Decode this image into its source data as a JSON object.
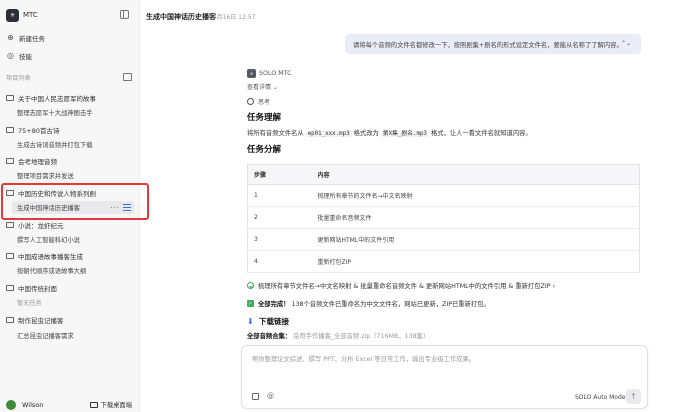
{
  "sidebar": {
    "brand": "MTC",
    "new_task": "新建任务",
    "skills": "技能",
    "section_projects": "项目列表",
    "groups": [
      {
        "label": "关于中国人民志愿军的故事",
        "children": [
          "整理志愿军十大战神图击手"
        ]
      },
      {
        "label": "75+80首古诗",
        "children": [
          "生成古诗词音频并打包下载"
        ]
      },
      {
        "label": "会考地理音频",
        "children": [
          "整理项目需求并发送"
        ]
      },
      {
        "label": "中国历史和传说人物系列剧",
        "children": [
          "生成中国神话历史播客"
        ]
      },
      {
        "label": "小说：龙虾纪元",
        "children": [
          "撰写人工智能科幻小说"
        ]
      },
      {
        "label": "中国成语故事播客生成",
        "children": [
          "按朝代顺序成语故事大纲"
        ]
      },
      {
        "label": "中国传统封面",
        "children": []
      }
    ],
    "section_temp": "暂无任务",
    "extra_items": [
      "制作昆虫记播客",
      "汇总昆虫记播客需求"
    ],
    "user": "Wilson",
    "download": "下载桌面端"
  },
  "header": {
    "title": "生成中国神话历史播客",
    "time": "04月16日 12:57"
  },
  "chat": {
    "user_message": "请将每个音频的文件名都修改一下，按照剧集+剧名的形式设定文件名，要能从名称了了解内容。",
    "agent_name": "SOLO MTC",
    "view_details": "查看详情 ⌄",
    "thinking": "思考",
    "section1_title": "任务理解",
    "section1_text_a": "将所有音频文件名从",
    "section1_code_a": "ep01_xxx.mp3",
    "section1_text_b": "格式改为",
    "section1_code_b": "第X集_剧名.mp3",
    "section1_text_c": "格式，让人一看文件名就知道内容。",
    "section2_title": "任务分解",
    "table_headers": [
      "步骤",
      "内容"
    ],
    "table_rows": [
      [
        "1",
        "梳理所有章节的文件名→中文名映射"
      ],
      [
        "2",
        "批量重命名音频文件"
      ],
      [
        "3",
        "更新网站HTML中的文件引用"
      ],
      [
        "4",
        "重新打包ZIP"
      ]
    ],
    "progress_line": "梳理所有章节文件名→中文名映射 & 批量重命名音频文件 & 更新网站HTML中的文件引用 & 重新打包ZIP ›",
    "done_label": "全部完成！",
    "done_text": "138个音频文件已重命名为中文文件名，网站已更新，ZIP已重新打包。",
    "download_title": "下载链接",
    "download_faint": "全部音频合集：",
    "download_faint2": "岳哥手作播客_全部音频.zip（716MB，138集）"
  },
  "input": {
    "placeholder": "帮你整理论文综述、撰写 PPT、分析 Excel 等日常工作，输出专业级工作成果。",
    "model": "SOLO Auto Model"
  }
}
